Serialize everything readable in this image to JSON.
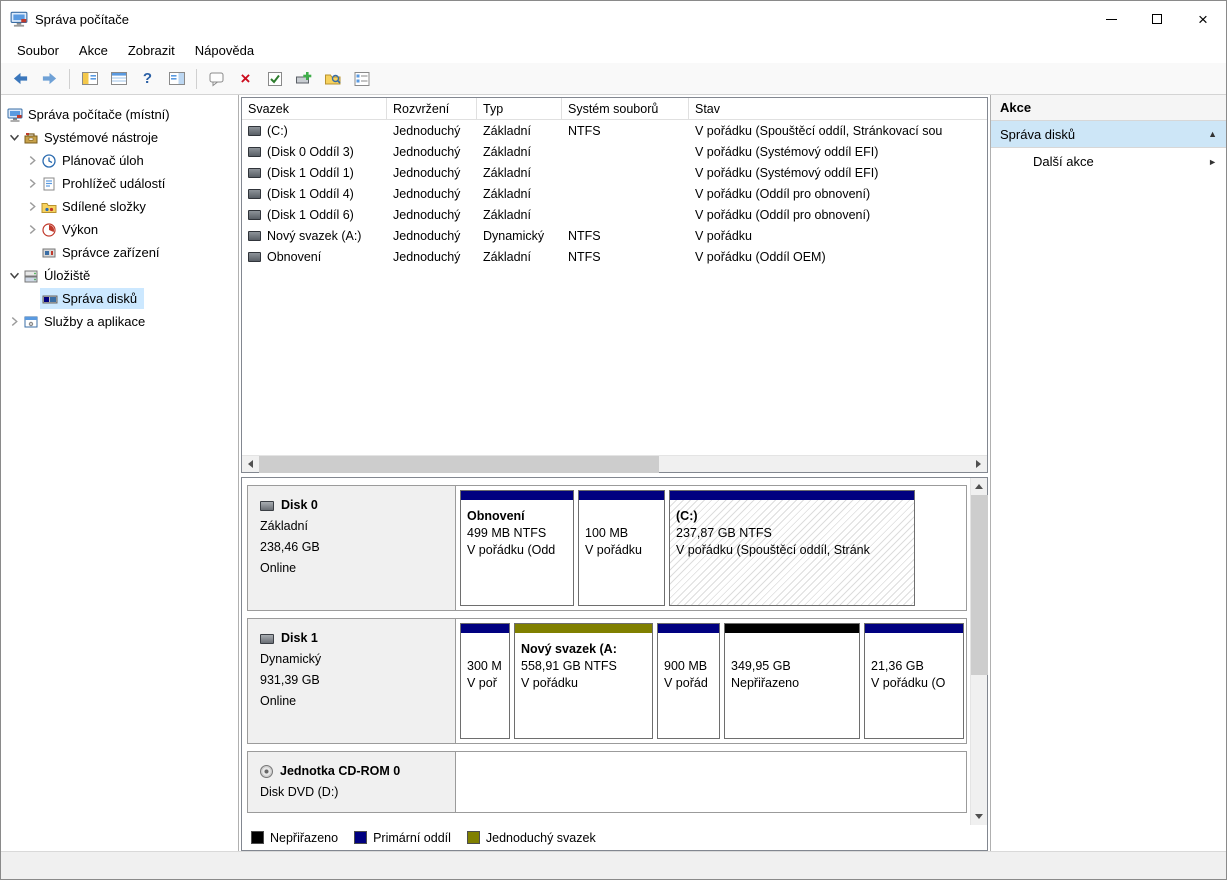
{
  "window": {
    "title": "Správa počítače"
  },
  "menu": {
    "items": {
      "file": "Soubor",
      "action": "Akce",
      "view": "Zobrazit",
      "help": "Nápověda"
    }
  },
  "tree": {
    "root": "Správa počítače (místní)",
    "system_tools": "Systémové nástroje",
    "task_scheduler": "Plánovač úloh",
    "event_viewer": "Prohlížeč událostí",
    "shared_folders": "Sdílené složky",
    "performance": "Výkon",
    "device_manager": "Správce zařízení",
    "storage": "Úložiště",
    "disk_management": "Správa disků",
    "services_apps": "Služby a aplikace"
  },
  "volumes": {
    "columns": {
      "volume": "Svazek",
      "layout": "Rozvržení",
      "type": "Typ",
      "fs": "Systém souborů",
      "status": "Stav"
    },
    "rows": [
      {
        "name": "(C:)",
        "layout": "Jednoduchý",
        "type": "Základní",
        "fs": "NTFS",
        "status": "V pořádku (Spouštěcí oddíl, Stránkovací sou"
      },
      {
        "name": "(Disk 0 Oddíl 3)",
        "layout": "Jednoduchý",
        "type": "Základní",
        "fs": "",
        "status": "V pořádku (Systémový oddíl EFI)"
      },
      {
        "name": "(Disk 1 Oddíl 1)",
        "layout": "Jednoduchý",
        "type": "Základní",
        "fs": "",
        "status": "V pořádku (Systémový oddíl EFI)"
      },
      {
        "name": "(Disk 1 Oddíl 4)",
        "layout": "Jednoduchý",
        "type": "Základní",
        "fs": "",
        "status": "V pořádku (Oddíl pro obnovení)"
      },
      {
        "name": "(Disk 1 Oddíl 6)",
        "layout": "Jednoduchý",
        "type": "Základní",
        "fs": "",
        "status": "V pořádku (Oddíl pro obnovení)"
      },
      {
        "name": "Nový svazek (A:)",
        "layout": "Jednoduchý",
        "type": "Dynamický",
        "fs": "NTFS",
        "status": "V pořádku"
      },
      {
        "name": "Obnovení",
        "layout": "Jednoduchý",
        "type": "Základní",
        "fs": "NTFS",
        "status": "V pořádku (Oddíl OEM)"
      }
    ]
  },
  "disks": {
    "disk0": {
      "name": "Disk 0",
      "type": "Základní",
      "size": "238,46 GB",
      "status": "Online",
      "partitions": [
        {
          "title": "Obnovení",
          "size": "499 MB NTFS",
          "status": "V pořádku (Odd",
          "color": "#000080"
        },
        {
          "title": "",
          "size": "100 MB",
          "status": "V pořádku",
          "color": "#000080"
        },
        {
          "title": "(C:)",
          "size": "237,87 GB NTFS",
          "status": "V pořádku (Spouštěcí oddíl, Stránk",
          "color": "#000080"
        }
      ]
    },
    "disk1": {
      "name": "Disk 1",
      "type": "Dynamický",
      "size": "931,39 GB",
      "status": "Online",
      "partitions": [
        {
          "title": "",
          "size": "300 M",
          "status": "V poř",
          "color": "#000080"
        },
        {
          "title": "Nový svazek  (A:",
          "size": "558,91 GB NTFS",
          "status": "V pořádku",
          "color": "#808000"
        },
        {
          "title": "",
          "size": "900 MB",
          "status": "V pořád",
          "color": "#000080"
        },
        {
          "title": "",
          "size": "349,95 GB",
          "status": "Nepřiřazeno",
          "color": "#000000"
        },
        {
          "title": "",
          "size": "21,36 GB",
          "status": "V pořádku (O",
          "color": "#000080"
        }
      ]
    },
    "cdrom": {
      "name": "Jednotka CD-ROM 0",
      "media": "Disk DVD (D:)"
    }
  },
  "legend": {
    "items": [
      {
        "label": "Nepřiřazeno",
        "color": "#000000"
      },
      {
        "label": "Primární oddíl",
        "color": "#000080"
      },
      {
        "label": "Jednoduchý svazek",
        "color": "#808000"
      }
    ]
  },
  "actions": {
    "title": "Akce",
    "section": "Správa disků",
    "more": "Další akce"
  },
  "colors": {
    "selection": "#cce8ff",
    "primary_partition": "#000080",
    "simple_volume": "#808000",
    "unallocated": "#000000"
  }
}
